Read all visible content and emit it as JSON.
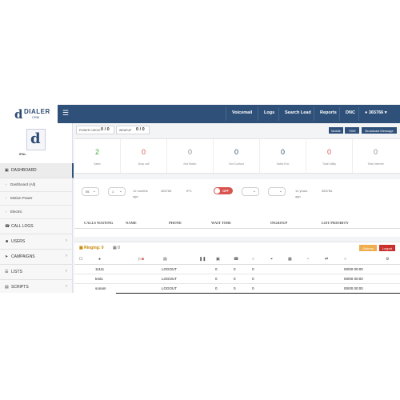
{
  "header": {
    "logo_text": "DIALER",
    "logo_sub": "CRM",
    "nav": [
      "Voicemail",
      "Logs",
      "Search Lead",
      "Reports",
      "DNC"
    ],
    "user": "365766"
  },
  "sidebar": {
    "profile_name": "IPAL",
    "menu": [
      {
        "icon": "dashboard-icon",
        "label": "DASHBOARD"
      },
      {
        "icon": "phone-icon",
        "label": "CALL LOGS"
      },
      {
        "icon": "users-icon",
        "label": "USERS"
      },
      {
        "icon": "campaign-icon",
        "label": "CAMPAIGNS"
      },
      {
        "icon": "list-icon",
        "label": "LISTS"
      },
      {
        "icon": "scripts-icon",
        "label": "SCRIPTS"
      }
    ],
    "submenu": [
      "Dashboard (All)",
      "Motion Power",
      "Electric"
    ]
  },
  "top": {
    "power_check_label": "POWER CHECK",
    "power_check_value": "0 / 0",
    "wrapup_label": "WRAPUP",
    "wrapup_value": "0 / 0",
    "buttons": [
      "Mobile",
      "7005",
      "Broadcast Message"
    ]
  },
  "stats": [
    {
      "value": "2",
      "label": "Sales",
      "color": "#3aaa35"
    },
    {
      "value": "0",
      "label": "Drop call",
      "color": "#d9534f"
    },
    {
      "value": "0",
      "label": "Not Match",
      "color": "#8a8f98"
    },
    {
      "value": "0",
      "label": "Not Contact",
      "color": "#2f5179"
    },
    {
      "value": "0",
      "label": "Sales Enc",
      "color": "#2f5179"
    },
    {
      "value": "0",
      "label": "Total Utility",
      "color": "#d9534f"
    },
    {
      "value": "0",
      "label": "Total Internet",
      "color": "#8a8f98"
    }
  ],
  "filters": {
    "sel1": "05",
    "sel2": "1",
    "age_text_1": "12 months",
    "age_sub_1": "ago",
    "code_1": "365766",
    "ipc": "IPC",
    "toggle": "OFF",
    "age_text_2": "12 years",
    "age_sub_2": "ago",
    "code_2": "365766"
  },
  "calls_table": {
    "headers": [
      "CALLS WAITING",
      "NAME",
      "PHONE",
      "WAIT TIME",
      "INGROUP",
      "LIST PRIORITY"
    ]
  },
  "agents": {
    "ringing_label": "Ringing: 0",
    "queue_count": "0",
    "options_label": "Options",
    "logout_label": "Logout",
    "rows": [
      {
        "name": "11111",
        "status": "LOGOUT",
        "a": "0",
        "b": "0",
        "c": "0",
        "time": "00/00 00:00"
      },
      {
        "name": "test1",
        "status": "LOGOUT",
        "a": "0",
        "b": "0",
        "c": "0",
        "time": "00/00 00:00"
      },
      {
        "name": "sonam",
        "status": "LOGOUT",
        "a": "0",
        "b": "0",
        "c": "0",
        "time": "00/00 00:00"
      }
    ]
  },
  "colors": {
    "brand": "#2f5179",
    "danger": "#d9534f",
    "warning": "#f0ad4e",
    "success": "#3aaa35"
  }
}
